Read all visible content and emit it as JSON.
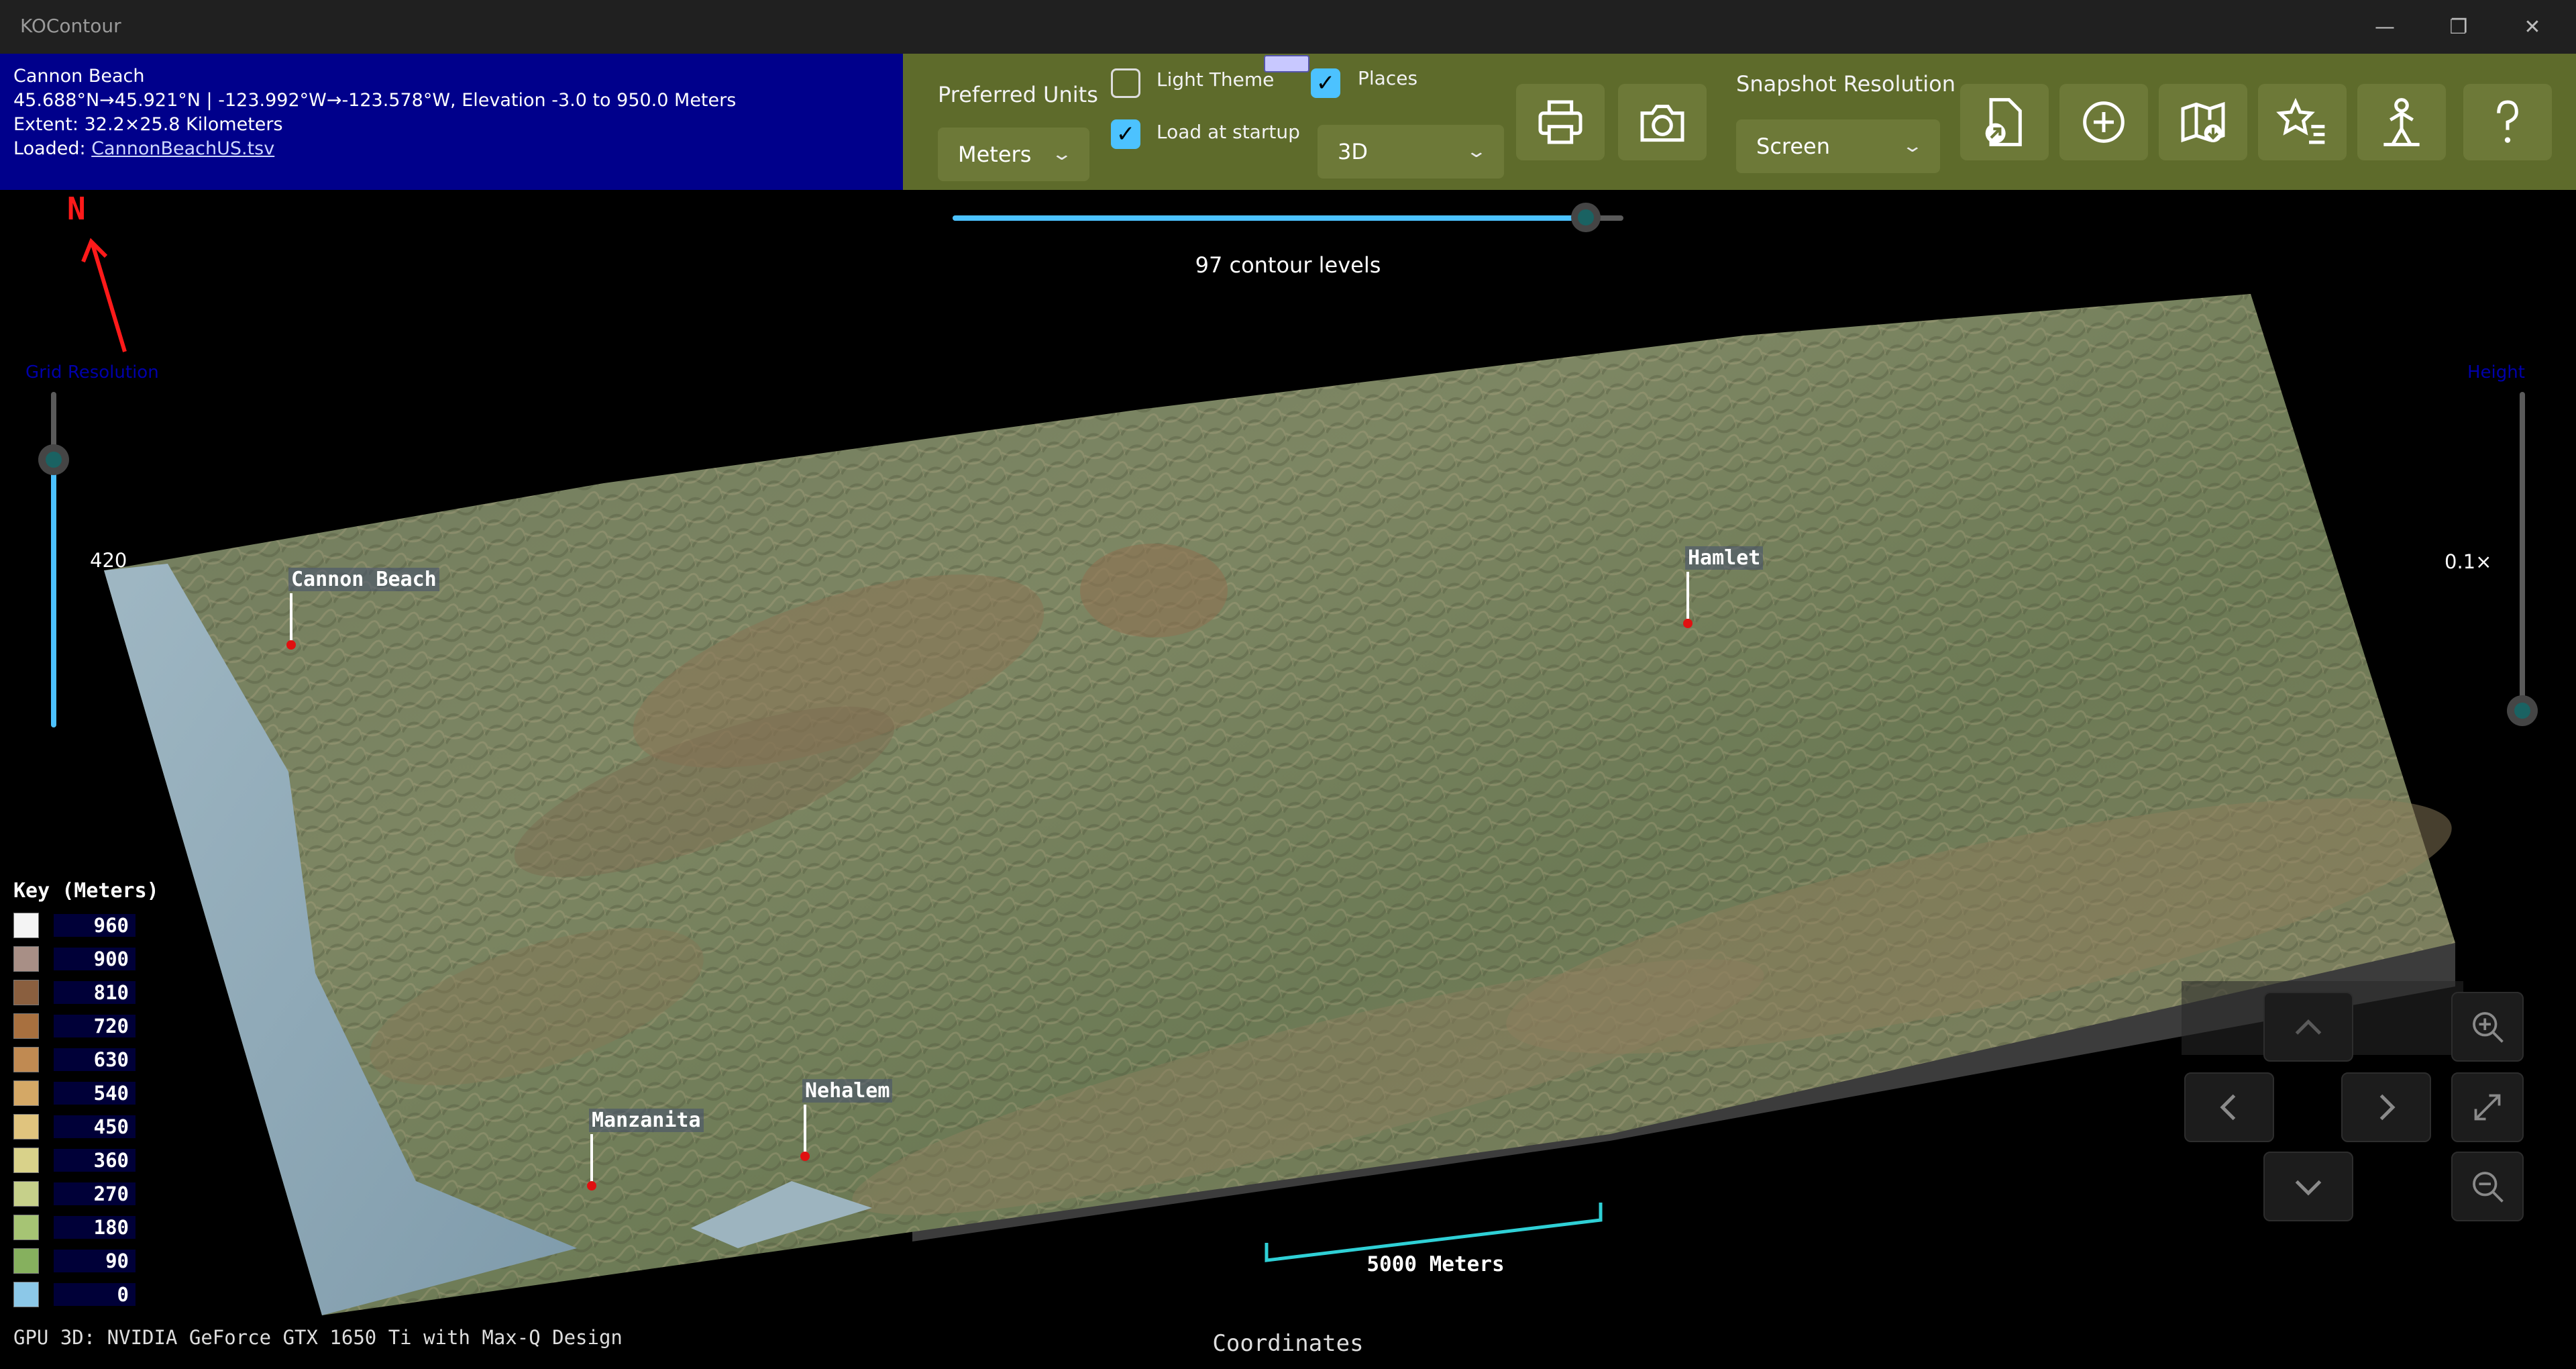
{
  "app": {
    "title": "KOContour",
    "window_controls": [
      "minimize",
      "restore",
      "close"
    ]
  },
  "info": {
    "place": "Cannon Beach",
    "coords_line": "45.688°N→45.921°N | -123.992°W→-123.578°W, Elevation -3.0 to 950.0 Meters",
    "extent": "Extent: 32.2×25.8 Kilometers",
    "loaded_prefix": "Loaded: ",
    "loaded_file": "CannonBeachUS.tsv"
  },
  "toolbar": {
    "preferred_units_label": "Preferred Units",
    "units_value": "Meters",
    "light_theme_label": "Light Theme",
    "light_theme_checked": false,
    "load_startup_label": "Load at startup",
    "load_startup_checked": true,
    "places_label": "Places",
    "places_checked": true,
    "view_mode_value": "3D",
    "snapshot_label": "Snapshot Resolution",
    "snapshot_value": "Screen",
    "icons": [
      "print-icon",
      "camera-icon",
      "open-file-icon",
      "add-icon",
      "map-download-icon",
      "favorites-icon",
      "hiker-icon",
      "help-icon"
    ]
  },
  "contour": {
    "levels_text": "97 contour levels",
    "slider_fraction": 0.94
  },
  "compass": {
    "label": "N"
  },
  "grid_resolution": {
    "label": "Grid Resolution",
    "value": "420",
    "fraction": 0.82
  },
  "height": {
    "label": "Height",
    "value": "0.1×",
    "fraction": 0.0
  },
  "places": [
    {
      "name": "Cannon Beach"
    },
    {
      "name": "Hamlet"
    },
    {
      "name": "Manzanita"
    },
    {
      "name": "Nehalem"
    }
  ],
  "key": {
    "title": "Key (Meters)",
    "items": [
      {
        "value": "960",
        "color": "#f4f4f4"
      },
      {
        "value": "900",
        "color": "#a88f86"
      },
      {
        "value": "810",
        "color": "#8a5f3f"
      },
      {
        "value": "720",
        "color": "#a8703f"
      },
      {
        "value": "630",
        "color": "#c08a52"
      },
      {
        "value": "540",
        "color": "#d4a866"
      },
      {
        "value": "450",
        "color": "#e0c47e"
      },
      {
        "value": "360",
        "color": "#d9d28a"
      },
      {
        "value": "270",
        "color": "#c6d08a"
      },
      {
        "value": "180",
        "color": "#a6c474"
      },
      {
        "value": "90",
        "color": "#86b05e"
      },
      {
        "value": "0",
        "color": "#8cc8e8"
      }
    ]
  },
  "scale_bar": {
    "label": "5000 Meters"
  },
  "footer": {
    "gpu": "GPU 3D: NVIDIA GeForce GTX 1650 Ti with Max-Q Design",
    "coordinates": "Coordinates"
  },
  "nav": [
    "pan-up",
    "pan-left",
    "pan-right",
    "pan-down",
    "zoom-in",
    "fit-view",
    "zoom-out"
  ]
}
